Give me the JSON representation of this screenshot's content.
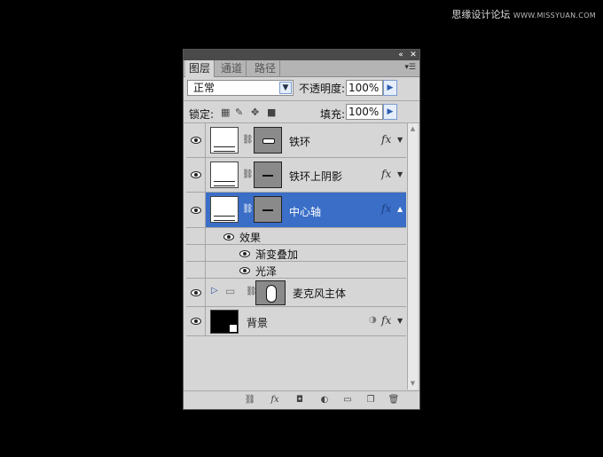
{
  "watermark": {
    "cn": "思缘设计论坛",
    "en": "WWW.MISSYUAN.COM"
  },
  "panel": {
    "tabs": [
      "图层",
      "通道",
      "路径"
    ],
    "blend_mode": "正常",
    "opacity_label": "不透明度:",
    "opacity_value": "100%",
    "lock_label": "锁定:",
    "fill_label": "填充:",
    "fill_value": "100%",
    "layers": [
      {
        "name": "铁环",
        "fx": "fx"
      },
      {
        "name": "铁环上阴影",
        "fx": "fx"
      },
      {
        "name": "中心轴",
        "fx": "fx",
        "selected": true
      },
      {
        "name": "麦克风主体"
      },
      {
        "name": "背景",
        "fx": "fx"
      }
    ],
    "effects": {
      "header": "效果",
      "items": [
        "渐变叠加",
        "光泽"
      ]
    }
  }
}
